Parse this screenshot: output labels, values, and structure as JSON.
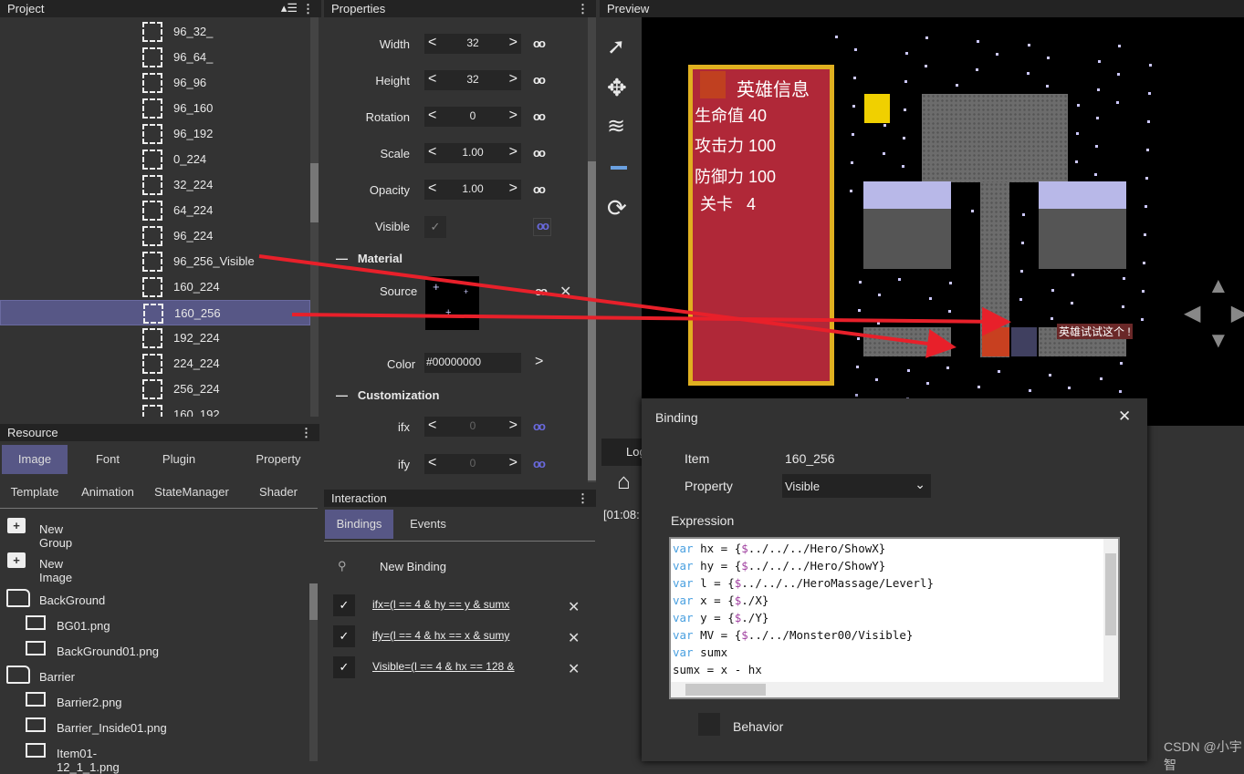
{
  "project": {
    "title": "Project",
    "items": [
      "96_32_",
      "96_64_",
      "96_96",
      "96_160",
      "96_192",
      "0_224",
      "32_224",
      "64_224",
      "96_224",
      "96_256_Visible",
      "160_224",
      "160_256",
      "192_224",
      "224_224",
      "256_224",
      "160_192"
    ],
    "selected": "160_256"
  },
  "resource": {
    "title": "Resource",
    "tabs": [
      "Image",
      "Font",
      "Plugin",
      "Property",
      "Template",
      "Animation",
      "StateManager",
      "Shader"
    ],
    "active_tab": "Image",
    "actions": [
      "New Group",
      "New Image"
    ],
    "tree": [
      {
        "type": "folder",
        "label": "BackGround"
      },
      {
        "type": "file",
        "label": "BG01.png"
      },
      {
        "type": "file",
        "label": "BackGround01.png"
      },
      {
        "type": "folder",
        "label": "Barrier"
      },
      {
        "type": "file",
        "label": "Barrier2.png"
      },
      {
        "type": "file",
        "label": "Barrier_Inside01.png"
      },
      {
        "type": "file",
        "label": "Item01-12_1_1.png"
      }
    ]
  },
  "properties": {
    "title": "Properties",
    "rows": [
      {
        "label": "Width",
        "value": "32"
      },
      {
        "label": "Height",
        "value": "32"
      },
      {
        "label": "Rotation",
        "value": "0"
      },
      {
        "label": "Scale",
        "value": "1.00"
      },
      {
        "label": "Opacity",
        "value": "1.00"
      }
    ],
    "visible_label": "Visible",
    "visible_checked": true,
    "material": {
      "title": "Material",
      "source_label": "Source",
      "color_label": "Color",
      "color_value": "#00000000"
    },
    "customization": {
      "title": "Customization",
      "rows": [
        {
          "label": "ifx",
          "value": "0"
        },
        {
          "label": "ify",
          "value": "0"
        }
      ]
    }
  },
  "interaction": {
    "title": "Interaction",
    "tabs": [
      "Bindings",
      "Events"
    ],
    "active_tab": "Bindings",
    "new_binding": "New Binding",
    "bindings": [
      "ifx=(l == 4 & hy == y & sumx",
      "ify=(l == 4 & hx == x & sumy",
      "Visible=(l == 4 & hx == 128 &"
    ]
  },
  "preview": {
    "title": "Preview",
    "hero_panel": {
      "title": "英雄信息",
      "hp": "生命值 40",
      "atk": "攻击力 100",
      "def": "防御力 100",
      "level": "关卡",
      "level_value": "4"
    },
    "npc_text": "英雄试试这个 !"
  },
  "log": {
    "tab": "Log",
    "line": "[01:08:"
  },
  "dialog": {
    "title": "Binding",
    "item_label": "Item",
    "item_value": "160_256",
    "property_label": "Property",
    "property_value": "Visible",
    "expression_label": "Expression",
    "expression": [
      [
        "var",
        " hx = {",
        "$",
        "../../../Hero/ShowX}"
      ],
      [
        "var",
        " hy = {",
        "$",
        "../../../Hero/ShowY}"
      ],
      [
        "var",
        " l = {",
        "$",
        "../../../HeroMassage/Leverl}"
      ],
      [
        "var",
        " x = {",
        "$",
        "./X}"
      ],
      [
        "var",
        " y = {",
        "$",
        "./Y}"
      ],
      [
        "var",
        " MV = {",
        "$",
        "../../Monster00/Visible}"
      ],
      [
        "var",
        " sumx",
        "",
        ""
      ],
      [
        "",
        " sumx = x - hx",
        "",
        ""
      ]
    ],
    "behavior_label": "Behavior"
  },
  "watermark": "CSDN @小宇智",
  "colors": {
    "accent": "#575786",
    "panel": "#333333",
    "arrow": "#e8202a"
  }
}
